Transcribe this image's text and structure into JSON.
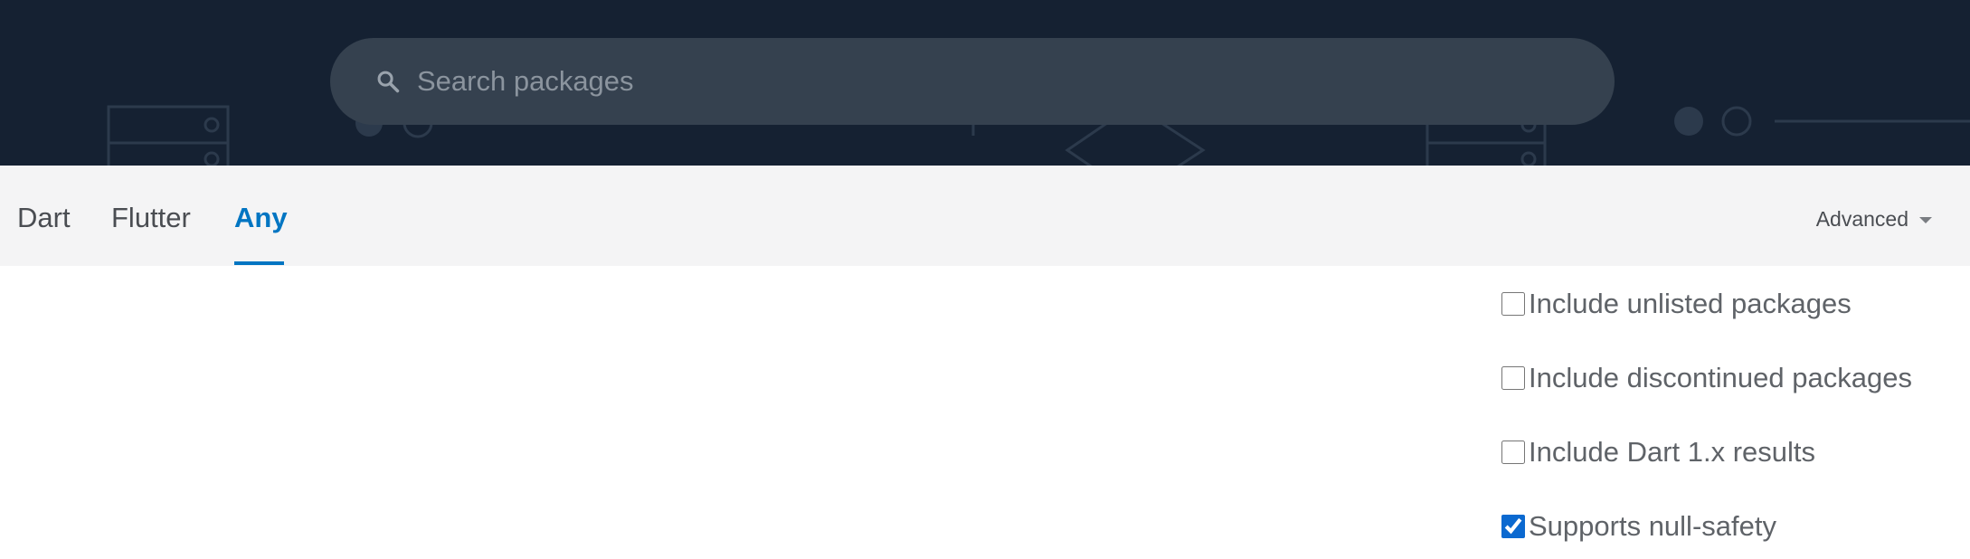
{
  "search": {
    "placeholder": "Search packages",
    "value": ""
  },
  "tabs": [
    {
      "label": "Dart",
      "active": false
    },
    {
      "label": "Flutter",
      "active": false
    },
    {
      "label": "Any",
      "active": true
    }
  ],
  "advanced": {
    "label": "Advanced"
  },
  "options": [
    {
      "label": "Include unlisted packages",
      "checked": false
    },
    {
      "label": "Include discontinued packages",
      "checked": false
    },
    {
      "label": "Include Dart 1.x results",
      "checked": false
    },
    {
      "label": "Supports null-safety",
      "checked": true
    }
  ],
  "colors": {
    "header_bg": "#152132",
    "search_bg": "#35414f",
    "tabs_bg": "#f4f4f5",
    "accent": "#0175c2",
    "checkbox_accent": "#0b69d0",
    "text_muted": "#5f6368",
    "decor_line": "#2c3a4c"
  },
  "icons": {
    "search": "search-icon",
    "advanced_caret": "caret-down-icon"
  }
}
